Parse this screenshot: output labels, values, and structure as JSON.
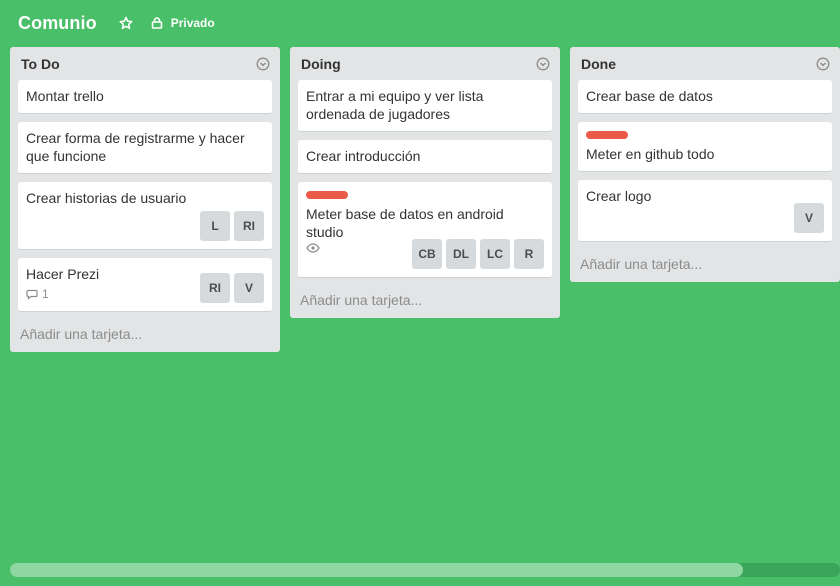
{
  "board": {
    "title": "Comunio",
    "star_icon": "star-icon",
    "privacy_icon": "lock-icon",
    "privacy_label": "Privado",
    "background": "#48bf68"
  },
  "lists": [
    {
      "title": "To Do",
      "add_card": "Añadir una tarjeta...",
      "cards": [
        {
          "text": "Montar trello"
        },
        {
          "text": "Crear forma de registrarme y hacer que funcione"
        },
        {
          "text": "Crear historias de usuario",
          "members": [
            "L",
            "RI"
          ]
        },
        {
          "text": "Hacer Prezi",
          "comments": "1",
          "members": [
            "RI",
            "V"
          ]
        }
      ]
    },
    {
      "title": "Doing",
      "add_card": "Añadir una tarjeta...",
      "cards": [
        {
          "text": "Entrar a mi equipo y ver lista ordenada de jugadores"
        },
        {
          "text": "Crear introducción"
        },
        {
          "text": "Meter base de datos en android studio",
          "label_color": "#eb5a46",
          "watching": true,
          "members": [
            "CB",
            "DL",
            "LC",
            "R"
          ]
        }
      ]
    },
    {
      "title": "Done",
      "add_card": "Añadir una tarjeta...",
      "cards": [
        {
          "text": "Crear base de datos"
        },
        {
          "text": "Meter en github todo",
          "label_color": "#eb5a46"
        },
        {
          "text": "Crear logo",
          "members": [
            "V"
          ]
        }
      ]
    }
  ],
  "colors": {
    "label_red": "#eb5a46",
    "list_bg": "#e2e4e6"
  }
}
